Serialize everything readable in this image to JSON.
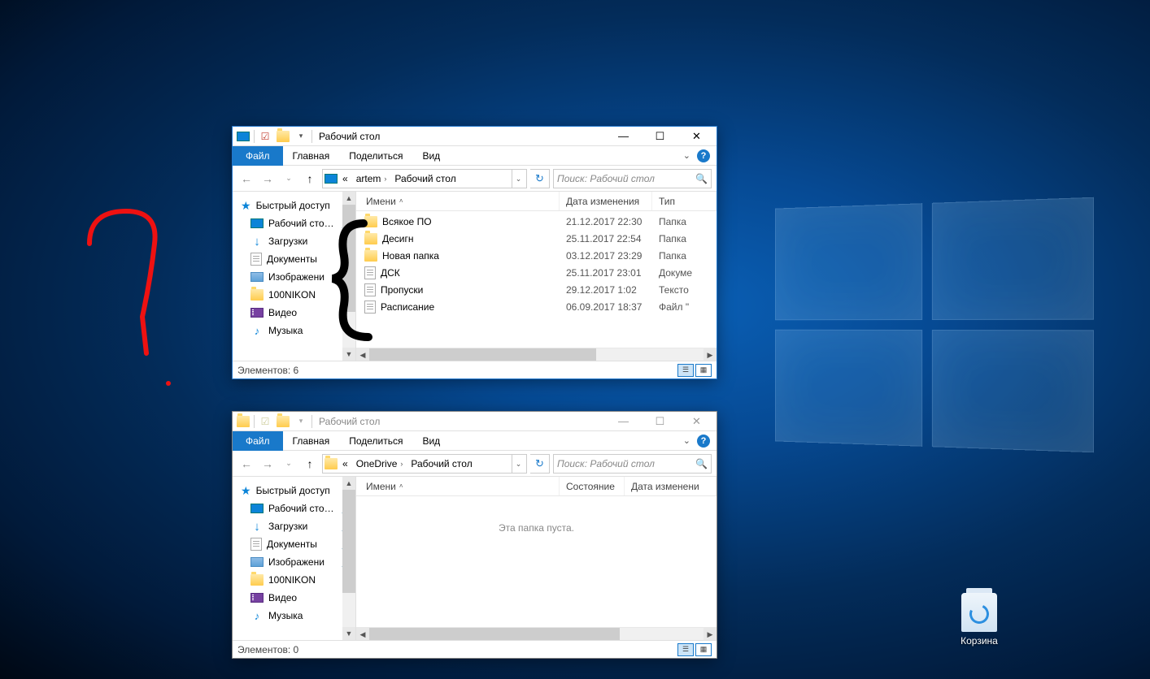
{
  "desktop": {
    "recycle_bin": "Корзина"
  },
  "window1": {
    "title": "Рабочий стол",
    "tabs": {
      "file": "Файл",
      "home": "Главная",
      "share": "Поделиться",
      "view": "Вид"
    },
    "breadcrumb": {
      "parent": "artem",
      "current": "Рабочий стол",
      "prefix": "«"
    },
    "search_placeholder": "Поиск: Рабочий стол",
    "columns": {
      "name": "Имени",
      "date": "Дата изменения",
      "type": "Тип"
    },
    "sidebar": {
      "quick_access": "Быстрый доступ",
      "items": [
        {
          "label": "Рабочий сто…",
          "icon": "monitor",
          "pinned": true
        },
        {
          "label": "Загрузки",
          "icon": "download",
          "pinned": true
        },
        {
          "label": "Документы",
          "icon": "doc",
          "pinned": true
        },
        {
          "label": "Изображени",
          "icon": "pic",
          "pinned": true
        },
        {
          "label": "100NIKON",
          "icon": "folder",
          "pinned": false
        },
        {
          "label": "Видео",
          "icon": "video",
          "pinned": false
        },
        {
          "label": "Музыка",
          "icon": "music",
          "pinned": false
        }
      ]
    },
    "files": [
      {
        "name": "Всякое ПО",
        "date": "21.12.2017 22:30",
        "type": "Папка",
        "icon": "folder"
      },
      {
        "name": "Десигн",
        "date": "25.11.2017 22:54",
        "type": "Папка",
        "icon": "folder"
      },
      {
        "name": "Новая папка",
        "date": "03.12.2017 23:29",
        "type": "Папка",
        "icon": "folder"
      },
      {
        "name": "ДСК",
        "date": "25.11.2017 23:01",
        "type": "Докуме",
        "icon": "doc"
      },
      {
        "name": "Пропуски",
        "date": "29.12.2017 1:02",
        "type": "Тексто",
        "icon": "doc"
      },
      {
        "name": "Расписание",
        "date": "06.09.2017 18:37",
        "type": "Файл \"",
        "icon": "doc"
      }
    ],
    "status": "Элементов: 6"
  },
  "window2": {
    "title": "Рабочий стол",
    "tabs": {
      "file": "Файл",
      "home": "Главная",
      "share": "Поделиться",
      "view": "Вид"
    },
    "breadcrumb": {
      "parent": "OneDrive",
      "current": "Рабочий стол",
      "prefix": "«"
    },
    "search_placeholder": "Поиск: Рабочий стол",
    "columns": {
      "name": "Имени",
      "state": "Состояние",
      "date": "Дата изменени"
    },
    "empty": "Эта папка пуста.",
    "sidebar": {
      "quick_access": "Быстрый доступ",
      "items": [
        {
          "label": "Рабочий сто…",
          "icon": "monitor",
          "pinned": true
        },
        {
          "label": "Загрузки",
          "icon": "download",
          "pinned": true
        },
        {
          "label": "Документы",
          "icon": "doc",
          "pinned": true
        },
        {
          "label": "Изображени",
          "icon": "pic",
          "pinned": true
        },
        {
          "label": "100NIKON",
          "icon": "folder",
          "pinned": false
        },
        {
          "label": "Видео",
          "icon": "video",
          "pinned": false
        },
        {
          "label": "Музыка",
          "icon": "music",
          "pinned": false
        }
      ]
    },
    "status": "Элементов: 0"
  }
}
